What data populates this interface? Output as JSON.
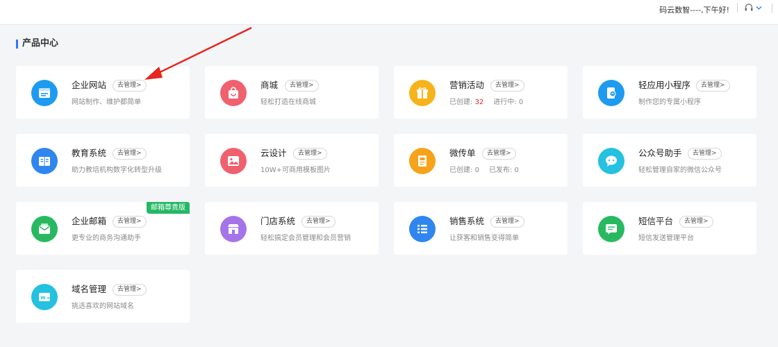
{
  "header": {
    "greeting": "码云数智----,下午好!",
    "support_icon": "headset-icon",
    "dropdown_icon": "chevron-down-icon"
  },
  "section": {
    "title": "产品中心"
  },
  "accent_color": "#2b7cf6",
  "manage_label": "去管理>",
  "cards": [
    {
      "name": "企业网站",
      "desc": "网站制作、维护都简单",
      "icon": "website-icon",
      "color": "#1e9bf0"
    },
    {
      "name": "商城",
      "desc": "轻松打造在线商城",
      "icon": "shopping-bag-icon",
      "color": "#f0616e"
    },
    {
      "name": "营销活动",
      "icon": "gift-icon",
      "color": "#f6b31b",
      "stats": [
        {
          "label": "已创建:",
          "value": "32",
          "highlight": true
        },
        {
          "label": "进行中:",
          "value": "0"
        }
      ]
    },
    {
      "name": "轻应用小程序",
      "desc": "制作您的专属小程序",
      "icon": "mini-program-icon",
      "color": "#1e9bf0"
    },
    {
      "name": "教育系统",
      "desc": "助力教培机构数字化转型升级",
      "icon": "book-icon",
      "color": "#2f86ee"
    },
    {
      "name": "云设计",
      "desc": "10W+可商用模板图片",
      "icon": "image-icon",
      "color": "#f0616e"
    },
    {
      "name": "微传单",
      "icon": "flyer-icon",
      "color": "#f6a21b",
      "stats": [
        {
          "label": "已创建:",
          "value": "0"
        },
        {
          "label": "已发布:",
          "value": "0"
        }
      ]
    },
    {
      "name": "公众号助手",
      "desc": "轻松管理自家的微信公众号",
      "icon": "wechat-icon",
      "color": "#24c1e0"
    },
    {
      "name": "企业邮箱",
      "desc": "更专业的商务沟通助手",
      "icon": "mail-icon",
      "color": "#28b960",
      "ribbon": "邮箱尊贵版"
    },
    {
      "name": "门店系统",
      "desc": "轻松搞定会员管理和会员营销",
      "icon": "store-icon",
      "color": "#a574e8"
    },
    {
      "name": "销售系统",
      "desc": "让获客和销售变得简单",
      "icon": "list-icon",
      "color": "#2f86ee"
    },
    {
      "name": "短信平台",
      "desc": "短信发送管理平台",
      "icon": "message-icon",
      "color": "#28b960"
    },
    {
      "name": "域名管理",
      "desc": "挑选喜欢的网站域名",
      "icon": "domain-icon",
      "color": "#24c1e0"
    }
  ]
}
